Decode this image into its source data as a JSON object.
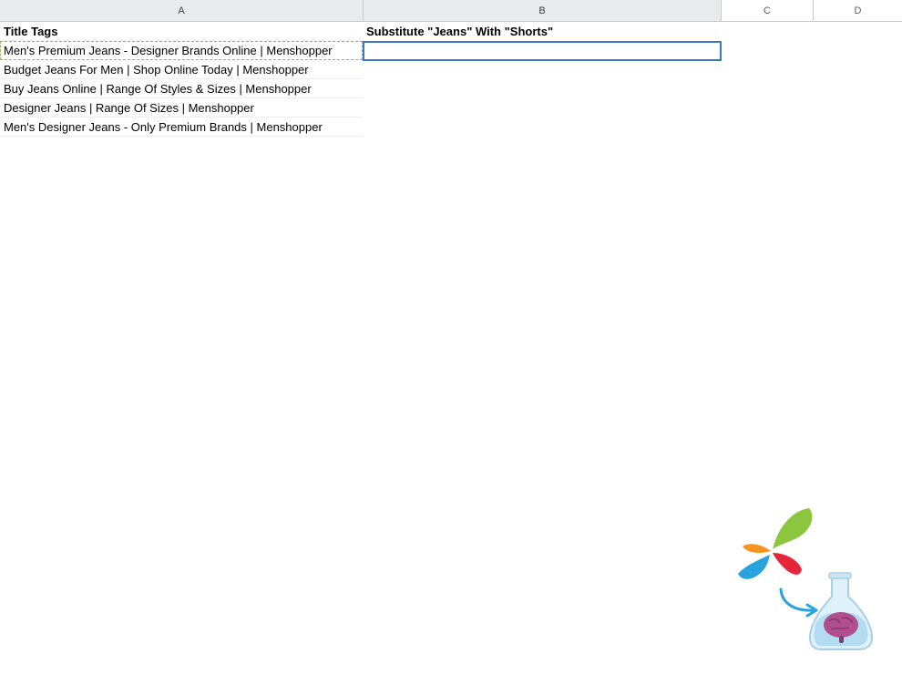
{
  "columns": [
    "A",
    "B",
    "C",
    "D"
  ],
  "rows": [
    {
      "a": "Title Tags",
      "b": "Substitute \"Jeans\" With \"Shorts\""
    },
    {
      "a": "Men's Premium Jeans - Designer Brands Online | Menshopper",
      "b": ""
    },
    {
      "a": "Budget Jeans For Men | Shop Online Today | Menshopper",
      "b": ""
    },
    {
      "a": "Buy Jeans Online | Range Of Styles & Sizes | Menshopper",
      "b": ""
    },
    {
      "a": "Designer Jeans | Range Of Sizes | Menshopper",
      "b": ""
    },
    {
      "a": "Men's Designer Jeans - Only Premium Brands | Menshopper",
      "b": ""
    }
  ],
  "logo_colors": {
    "green": "#8cc63f",
    "orange": "#f7941d",
    "blue": "#29a3dd",
    "red": "#e3263a",
    "brain": "#b04f8e"
  },
  "selection": {
    "active": "B2",
    "copy": "A2"
  }
}
